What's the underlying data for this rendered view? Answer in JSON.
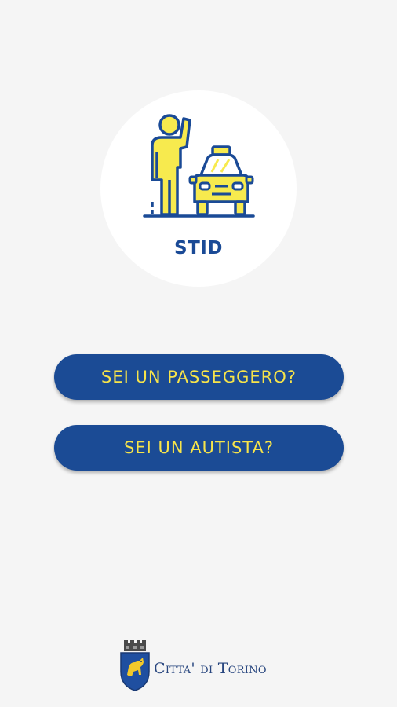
{
  "app": {
    "name": "STID",
    "logo_icon": "person-hailing-taxi-icon"
  },
  "actions": {
    "passenger_label": "SEI UN PASSEGGERO?",
    "driver_label": "SEI UN AUTISTA?"
  },
  "footer": {
    "city_name": "Citta' di Torino",
    "crest_icon": "torino-coat-of-arms-icon"
  },
  "colors": {
    "background": "#f5f5f5",
    "primary_blue": "#1b4b95",
    "accent_yellow": "#f7e44a"
  }
}
